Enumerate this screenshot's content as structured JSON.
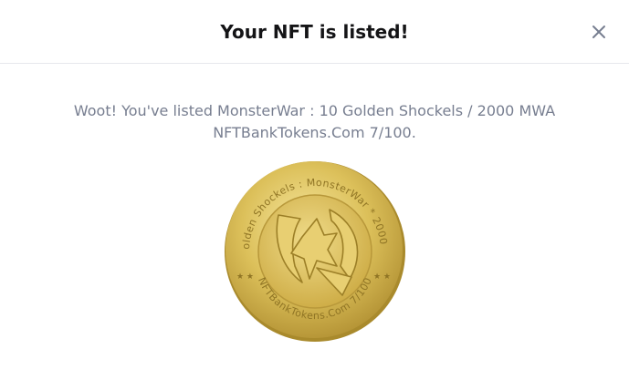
{
  "modal": {
    "title": "Your NFT is listed!",
    "close_icon": "close-icon",
    "message_line1": "Woot! You've listed MonsterWar : 10 Golden Shockels / 2000 MWA",
    "message_line2": "NFTBankTokens.Com 7/100.",
    "coin_top_text": "10 Golden Shockels : MonsterWar * 2000 MWA",
    "coin_bottom_text": "NFTBankTokens.Com 7/100"
  },
  "colors": {
    "title": "#141416",
    "message": "#777e90",
    "divider": "#e6e8ec",
    "close_icon": "#777e90",
    "coin_gold_light": "#f3df8a",
    "coin_gold": "#d9b94e",
    "coin_gold_dark": "#a98a2c"
  }
}
